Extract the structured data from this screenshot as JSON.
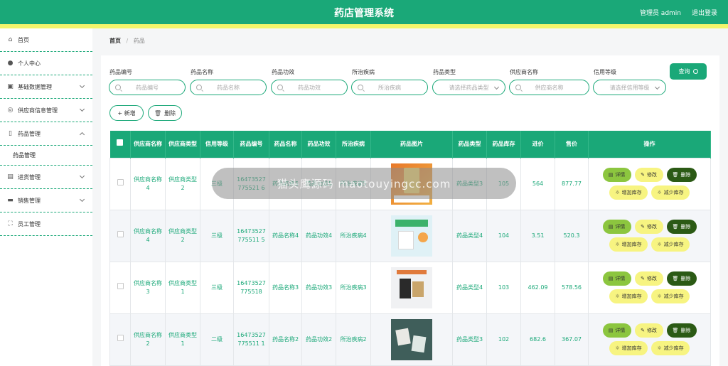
{
  "header": {
    "title": "药店管理系统",
    "user": "管理员 admin",
    "logout": "退出登录"
  },
  "sidebar": {
    "items": [
      {
        "label": "首页",
        "icon": "home-icon"
      },
      {
        "label": "个人中心",
        "icon": "person-icon"
      },
      {
        "label": "基础数据管理",
        "icon": "document-icon"
      },
      {
        "label": "供应商信息管理",
        "icon": "compass-icon"
      },
      {
        "label": "药品管理",
        "icon": "clipboard-icon"
      },
      {
        "label": "药品管理",
        "sub": true
      },
      {
        "label": "进货管理",
        "icon": "cart-icon"
      },
      {
        "label": "销售管理",
        "icon": "chat-icon"
      },
      {
        "label": "员工管理",
        "icon": "scan-icon"
      }
    ]
  },
  "breadcrumb": {
    "home": "首页",
    "sep": "/",
    "current": "药品"
  },
  "filters": [
    {
      "label": "药品编号",
      "placeholder": "药品编号",
      "type": "text"
    },
    {
      "label": "药品名称",
      "placeholder": "药品名称",
      "type": "text"
    },
    {
      "label": "药品功效",
      "placeholder": "药品功效",
      "type": "text"
    },
    {
      "label": "所治疾病",
      "placeholder": "所治疾病",
      "type": "text"
    },
    {
      "label": "药品类型",
      "placeholder": "请选择药品类型",
      "type": "select"
    },
    {
      "label": "供应商名称",
      "placeholder": "供应商名称",
      "type": "text"
    },
    {
      "label": "信用等级",
      "placeholder": "请选择信用等级",
      "type": "select"
    }
  ],
  "buttons": {
    "query": "查询",
    "add": "+ 新增",
    "delete": "删除"
  },
  "table": {
    "headers": [
      "供应商名称",
      "供应商类型",
      "信用等级",
      "药品编号",
      "药品名称",
      "药品功效",
      "所治疾病",
      "药品图片",
      "药品类型",
      "药品库存",
      "进价",
      "售价",
      "操作"
    ],
    "rows": [
      {
        "supplier": "供应商名称4",
        "stype": "供应商类型2",
        "credit": "三级",
        "code": "16473527775521 6",
        "name": "药品名称5",
        "effect": "药品功效5",
        "disease": "所治疾病5",
        "img": "p1",
        "dtype": "药品类型3",
        "stock": "105",
        "in": "564",
        "out": "877.77"
      },
      {
        "supplier": "供应商名称4",
        "stype": "供应商类型2",
        "credit": "三级",
        "code": "16473527775511 5",
        "name": "药品名称4",
        "effect": "药品功效4",
        "disease": "所治疾病4",
        "img": "p2",
        "dtype": "药品类型4",
        "stock": "104",
        "in": "3.51",
        "out": "520.3"
      },
      {
        "supplier": "供应商名称3",
        "stype": "供应商类型1",
        "credit": "三级",
        "code": "16473527775518",
        "name": "药品名称3",
        "effect": "药品功效3",
        "disease": "所治疾病3",
        "img": "p3",
        "dtype": "药品类型4",
        "stock": "103",
        "in": "462.09",
        "out": "578.56"
      },
      {
        "supplier": "供应商名称2",
        "stype": "供应商类型1",
        "credit": "二级",
        "code": "16473527775511 1",
        "name": "药品名称2",
        "effect": "药品功效2",
        "disease": "所治疾病2",
        "img": "p4",
        "dtype": "药品类型3",
        "stock": "102",
        "in": "682.6",
        "out": "367.07"
      }
    ],
    "ops": {
      "detail": "详情",
      "edit": "修改",
      "del": "删除",
      "inc": "增加库存",
      "dec": "减少库存"
    }
  },
  "watermark": "猫头鹰源码 maotouyingcc.com"
}
